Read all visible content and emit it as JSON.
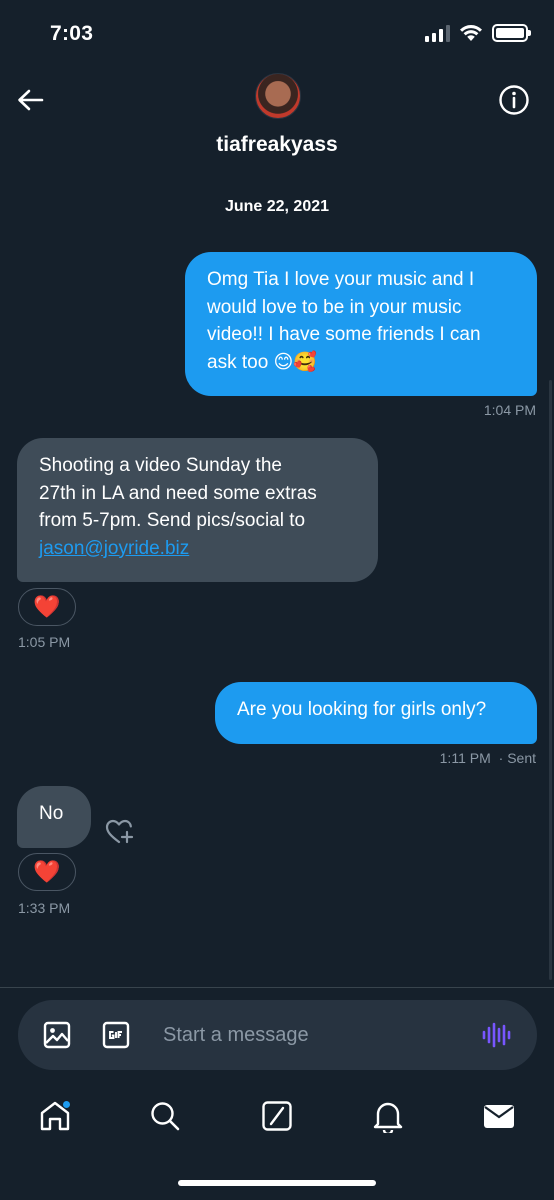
{
  "status_bar": {
    "time": "7:03"
  },
  "header": {
    "username": "tiafreakyass"
  },
  "conversation": {
    "date": "June 22, 2021",
    "messages": [
      {
        "direction": "outgoing",
        "lines": [
          "Omg Tia I love your music and I",
          "would love to be in your music",
          "video!! I have some friends I can",
          "ask too 😊🥰"
        ],
        "timestamp": "1:04 PM"
      },
      {
        "direction": "incoming",
        "lines": [
          "Shooting a video Sunday the",
          "27th in LA and need some extras",
          "from 5-7pm. Send pics/social to"
        ],
        "link": "jason@joyride.biz",
        "reaction": "❤️",
        "timestamp": "1:05 PM"
      },
      {
        "direction": "outgoing",
        "text": "Are you looking for girls only?",
        "timestamp": "1:11 PM",
        "status": "· Sent"
      },
      {
        "direction": "incoming",
        "text": "No",
        "reaction": "❤️",
        "timestamp": "1:33 PM"
      }
    ]
  },
  "composer": {
    "placeholder": "Start a message"
  },
  "colors": {
    "background": "#15202b",
    "accent": "#1d9bf0",
    "incoming_bubble": "#3f4c58",
    "muted_text": "#8b98a5",
    "composer_bg": "#273340",
    "voice_icon": "#7856ff"
  },
  "icons": {
    "back": "arrow-left-icon",
    "info": "info-icon",
    "add_reaction": "heart-plus-icon",
    "image": "image-icon",
    "gif": "gif-icon",
    "voice": "voice-wave-icon",
    "tabs": [
      "home-icon",
      "search-icon",
      "grok-icon",
      "bell-icon",
      "mail-icon"
    ]
  }
}
